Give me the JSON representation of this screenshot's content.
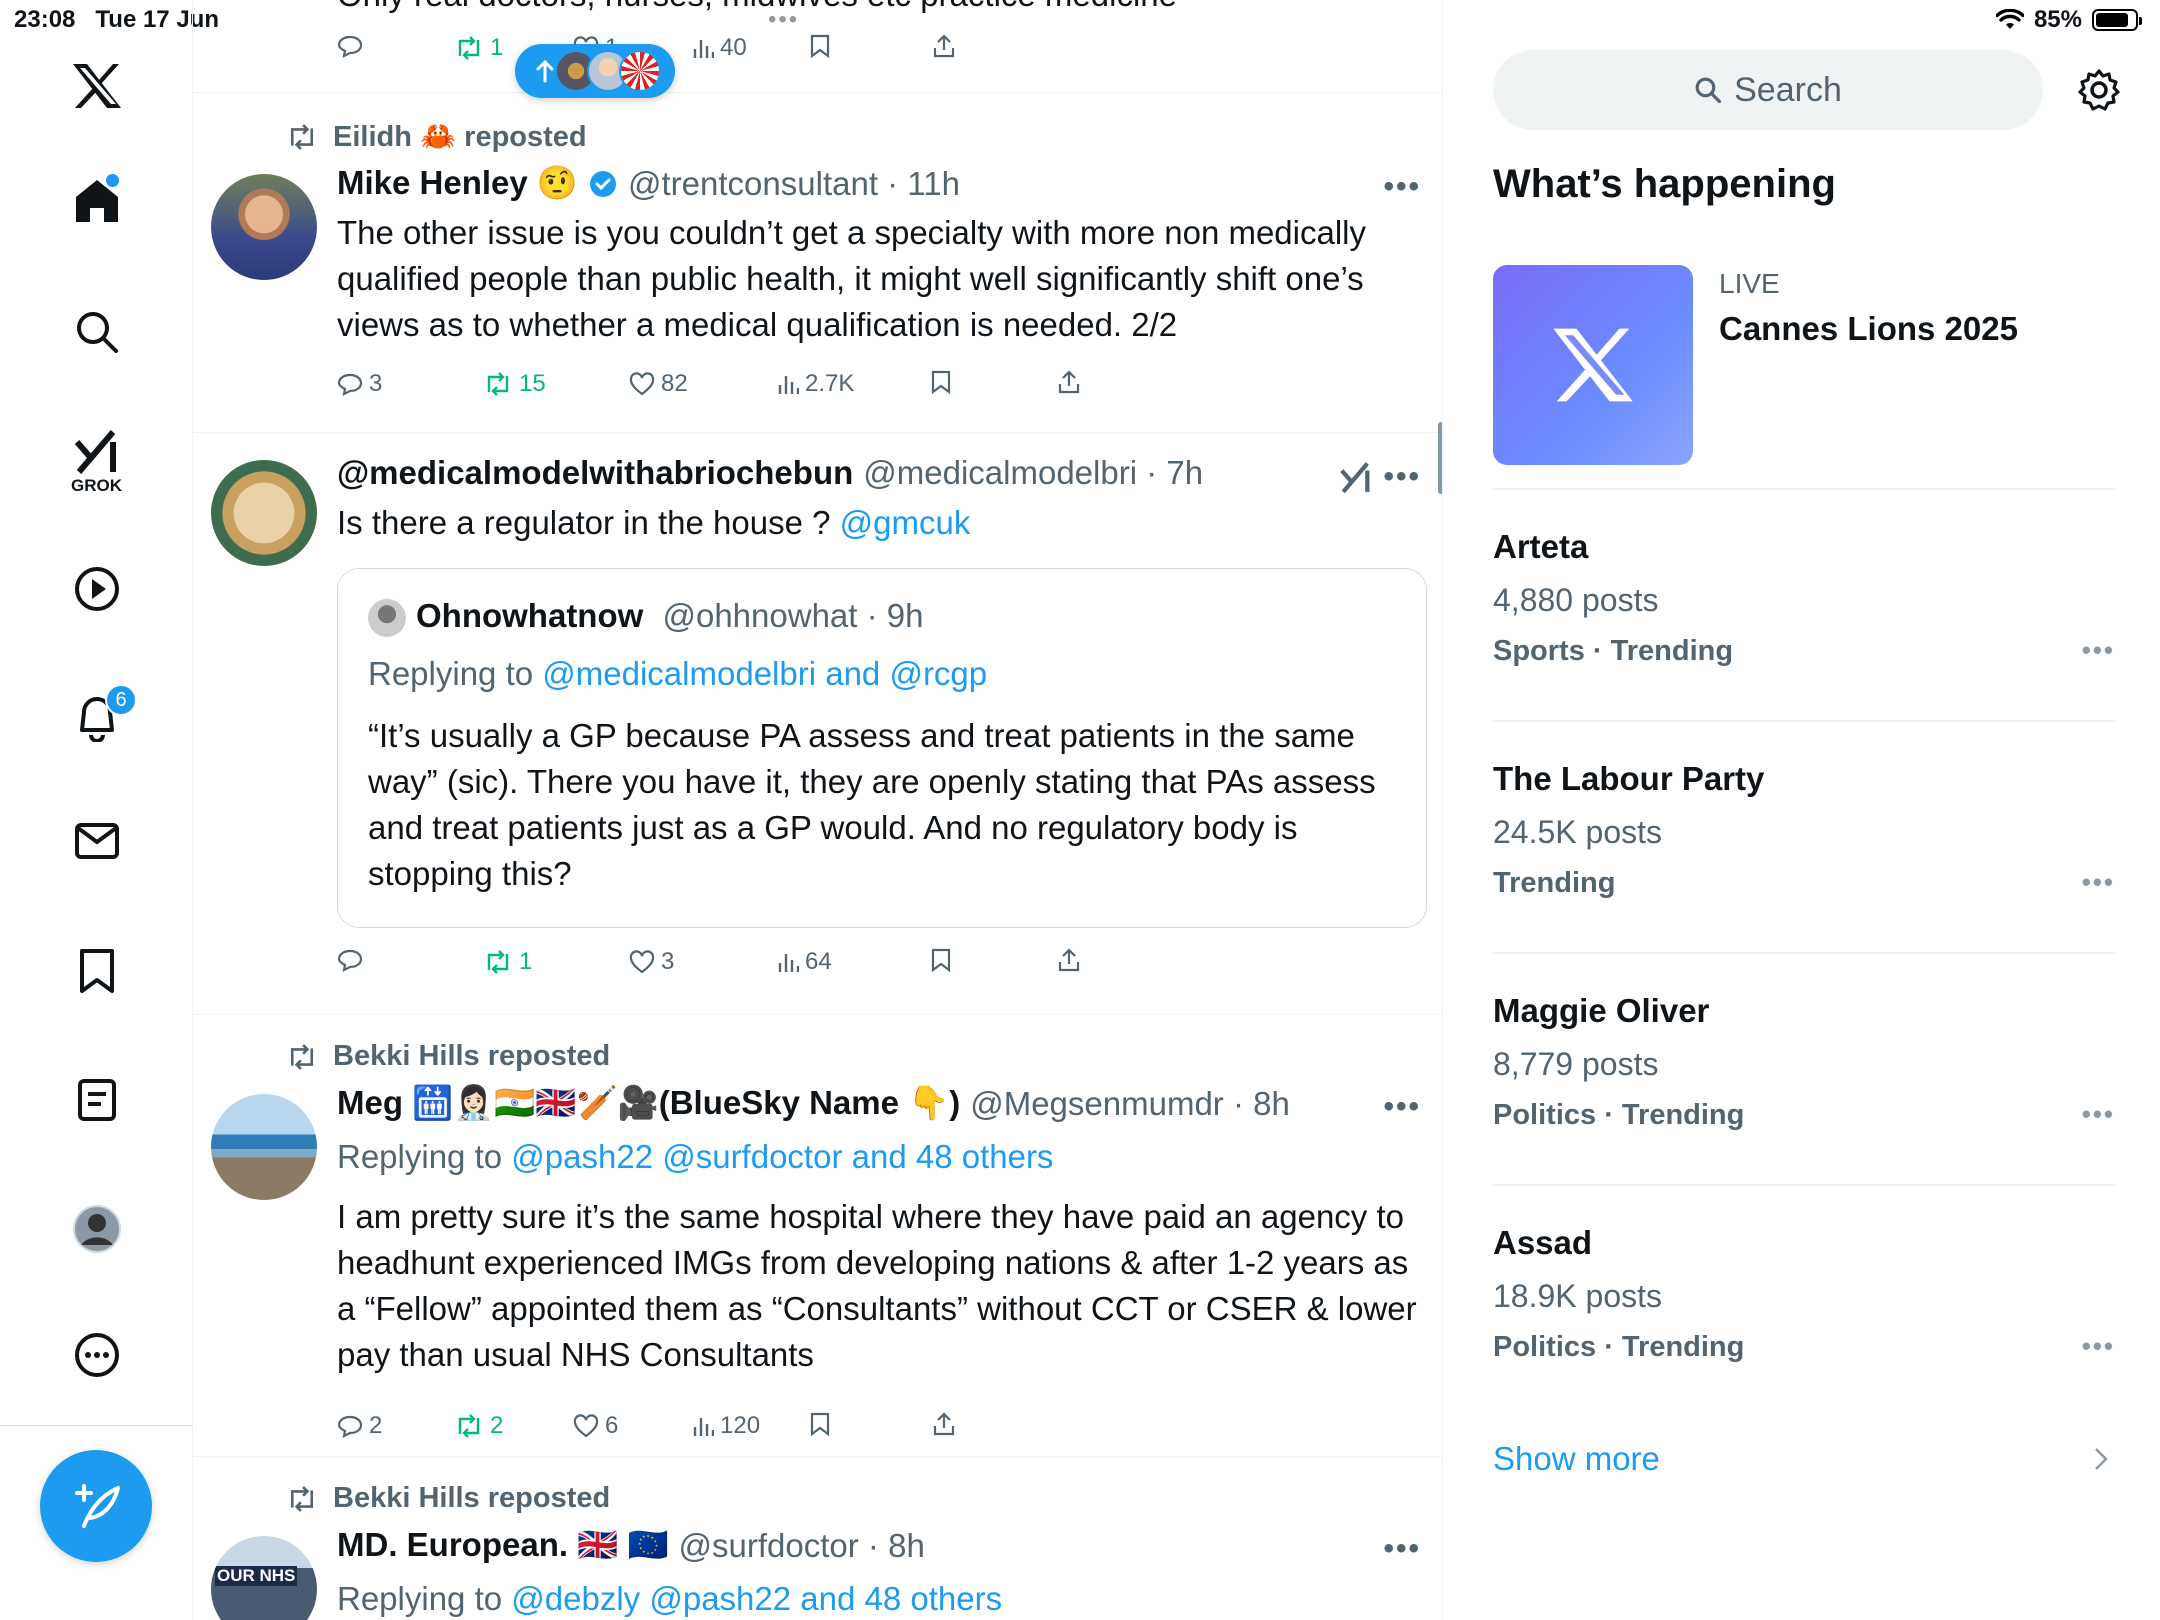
{
  "status": {
    "time": "23:08",
    "date": "Tue 17 Jun",
    "battery": "85%",
    "battery_level": 0.85
  },
  "nav": {
    "grok_label": "GROK",
    "notifications_badge": "6"
  },
  "top_post": {
    "text_partial": "Only real doctors, nurses, midwives etc practice medicine",
    "replies": "",
    "reposts": "1",
    "likes": "1",
    "views": "40"
  },
  "posts": [
    {
      "repost_by": "Eilidh 🦀 reposted",
      "name": "Mike Henley 🤨",
      "handle": "@trentconsultant · 11h",
      "text": "The other issue is you couldn’t get a specialty with more non medically qualified people than public health, it might well significantly shift one’s views as to whether a medical qualification is needed. 2/2",
      "replies": "3",
      "reposts": "15",
      "likes": "82",
      "views": "2.7K"
    },
    {
      "name": "@medicalmodelwithabriochebun",
      "handle": "@medicalmodelbri · 7h",
      "text": "Is there a regulator in the house ?",
      "text_link": "@gmcuk",
      "quote": {
        "name": "Ohnowhatnow",
        "handle": "@ohhnowhat · 9h",
        "replying_prefix": "Replying to",
        "replying_links": "@medicalmodelbri and @rcgp",
        "text": "“It’s usually a GP because PA assess and treat patients in the same way” (sic). There you have it, they are openly stating that PAs assess and treat patients just as a GP would. And no regulatory body is stopping this?"
      },
      "replies": "",
      "reposts": "1",
      "likes": "3",
      "views": "64"
    },
    {
      "repost_by": "Bekki Hills reposted",
      "name": "Meg 🛗👩🏻‍⚕️🇮🇳🇬🇧🏏🎥(BlueSky Name 👇)",
      "handle": "@Megsenmumdr · 8h",
      "replying_prefix": "Replying to",
      "replying_links": "@pash22 @surfdoctor and 48 others",
      "text": "I am pretty sure it’s the same hospital where they have paid an agency to headhunt experienced IMGs from developing nations & after 1-2 years as a “Fellow” appointed them as “Consultants” without CCT or CSER & lower pay than usual NHS Consultants",
      "replies": "2",
      "reposts": "2",
      "likes": "6",
      "views": "120"
    },
    {
      "repost_by": "Bekki Hills reposted",
      "name": "MD. European. 🇬🇧 🇪🇺",
      "handle": "@surfdoctor · 8h",
      "replying_prefix": "Replying to",
      "replying_links": "@debzly @pash22 and 48 others",
      "avatar_text": "OUR NHS"
    }
  ],
  "sidebar": {
    "search_placeholder": "Search",
    "section_title": "What’s happening",
    "live": {
      "tag": "LIVE",
      "title": "Cannes Lions 2025"
    },
    "trends": [
      {
        "name": "Arteta",
        "count": "4,880 posts",
        "category": "Sports · Trending"
      },
      {
        "name": "The Labour Party",
        "count": "24.5K posts",
        "category": "Trending"
      },
      {
        "name": "Maggie Oliver",
        "count": "8,779 posts",
        "category": "Politics · Trending"
      },
      {
        "name": "Assad",
        "count": "18.9K posts",
        "category": "Politics · Trending"
      }
    ],
    "show_more": "Show more"
  },
  "colors": {
    "accent": "#1d9bf0",
    "repost_green": "#00ba7c",
    "muted": "#536471"
  },
  "icons": [
    "x-logo-icon",
    "home-icon",
    "search-icon",
    "grok-icon",
    "video-icon",
    "bell-icon",
    "mail-icon",
    "bookmark-icon",
    "lists-icon",
    "profile-icon",
    "more-icon",
    "compose-icon",
    "reply-icon",
    "repost-icon",
    "like-icon",
    "views-icon",
    "share-icon",
    "gear-icon",
    "verified-icon"
  ]
}
